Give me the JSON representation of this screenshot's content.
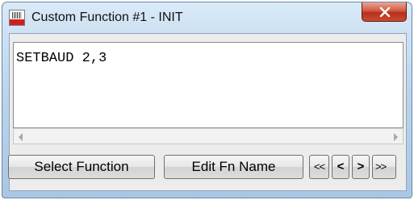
{
  "window": {
    "title": "Custom Function #1 - INIT",
    "app_icon": "pic-basic-icon",
    "close_icon": "close-icon",
    "close_color": "#c94a32"
  },
  "editor": {
    "code": "SETBAUD 2,3"
  },
  "scrollbar": {
    "left_arrow": "scroll-left-arrow-icon",
    "right_arrow": "scroll-right-arrow-icon"
  },
  "buttons": {
    "select_function": "Select Function",
    "edit_fn_name": "Edit Fn Name",
    "first": "<<",
    "prev": "<",
    "next": ">",
    "last": ">>"
  }
}
